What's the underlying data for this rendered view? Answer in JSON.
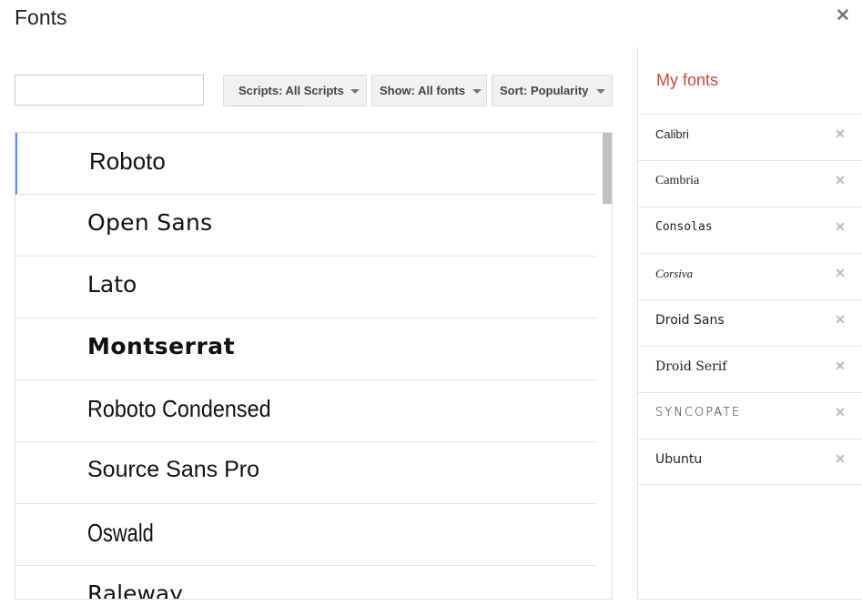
{
  "dialog": {
    "title": "Fonts",
    "close_icon": "close-icon"
  },
  "search": {
    "value": "",
    "placeholder": ""
  },
  "filters": {
    "scripts_label": "Scripts: All Scripts",
    "show_label": "Show: All fonts",
    "sort_label": "Sort: Popularity"
  },
  "font_list": [
    {
      "name": "Roboto",
      "selected": true
    },
    {
      "name": "Open Sans",
      "selected": false
    },
    {
      "name": "Lato",
      "selected": false
    },
    {
      "name": "Montserrat",
      "selected": false
    },
    {
      "name": "Roboto Condensed",
      "selected": false
    },
    {
      "name": "Source Sans Pro",
      "selected": false
    },
    {
      "name": "Oswald",
      "selected": false
    },
    {
      "name": "Raleway",
      "selected": false
    }
  ],
  "my_fonts": {
    "title": "My fonts",
    "items": [
      {
        "label": "Calibri"
      },
      {
        "label": "Cambria"
      },
      {
        "label": "Consolas"
      },
      {
        "label": "Corsiva"
      },
      {
        "label": "Droid Sans"
      },
      {
        "label": "Droid Serif"
      },
      {
        "label": "Syncopate"
      },
      {
        "label": "Ubuntu"
      }
    ],
    "remove_icon": "close-icon"
  },
  "colors": {
    "accent_red": "#d14836",
    "selection_blue": "#4d90fe",
    "button_bg": "#f1f1f1"
  }
}
